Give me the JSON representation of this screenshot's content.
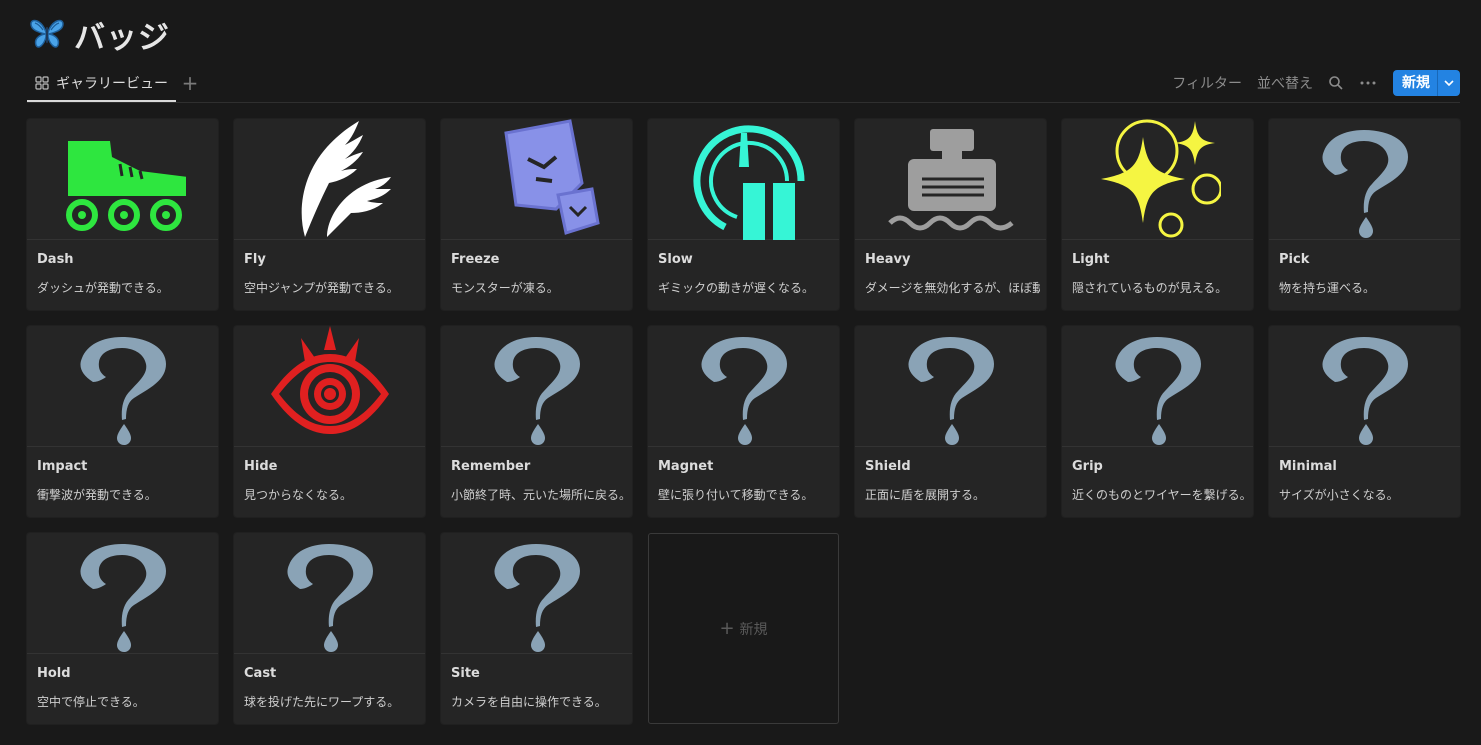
{
  "page": {
    "title": "バッジ",
    "icon": "butterfly-icon"
  },
  "toolbar": {
    "view_tab": "ギャラリービュー",
    "filter": "フィルター",
    "sort": "並べ替え",
    "new": "新規",
    "icons": [
      "gallery-grid-icon",
      "plus-icon",
      "search-icon",
      "more-icon",
      "chevron-down-icon"
    ]
  },
  "colors": {
    "accent": "#2383e2",
    "background": "#191919",
    "card": "#252525",
    "question": "#8aa3b6"
  },
  "cards": [
    {
      "name": "Dash",
      "desc": "ダッシュが発動できる。",
      "icon": "roller-skate-icon"
    },
    {
      "name": "Fly",
      "desc": "空中ジャンプが発動できる。",
      "icon": "wings-icon"
    },
    {
      "name": "Freeze",
      "desc": "モンスターが凍る。",
      "icon": "ice-cubes-icon"
    },
    {
      "name": "Slow",
      "desc": "ギミックの動きが遅くなる。",
      "icon": "slow-gauge-icon"
    },
    {
      "name": "Heavy",
      "desc": "ダメージを無効化するが、ほぼ動",
      "icon": "heavy-weight-icon"
    },
    {
      "name": "Light",
      "desc": "隠されているものが見える。",
      "icon": "sparkles-icon"
    },
    {
      "name": "Pick",
      "desc": "物を持ち運べる。",
      "icon": "question-mark-icon"
    },
    {
      "name": "Impact",
      "desc": "衝撃波が発動できる。",
      "icon": "question-mark-icon"
    },
    {
      "name": "Hide",
      "desc": "見つからなくなる。",
      "icon": "eye-icon"
    },
    {
      "name": "Remember",
      "desc": "小節終了時、元いた場所に戻る。",
      "icon": "question-mark-icon"
    },
    {
      "name": "Magnet",
      "desc": "壁に張り付いて移動できる。",
      "icon": "question-mark-icon"
    },
    {
      "name": "Shield",
      "desc": "正面に盾を展開する。",
      "icon": "question-mark-icon"
    },
    {
      "name": "Grip",
      "desc": "近くのものとワイヤーを繋げる。",
      "icon": "question-mark-icon"
    },
    {
      "name": "Minimal",
      "desc": "サイズが小さくなる。",
      "icon": "question-mark-icon"
    },
    {
      "name": "Hold",
      "desc": "空中で停止できる。",
      "icon": "question-mark-icon"
    },
    {
      "name": "Cast",
      "desc": "球を投げた先にワープする。",
      "icon": "question-mark-icon"
    },
    {
      "name": "Site",
      "desc": "カメラを自由に操作できる。",
      "icon": "question-mark-icon"
    }
  ],
  "new_card": {
    "label": "新規"
  }
}
